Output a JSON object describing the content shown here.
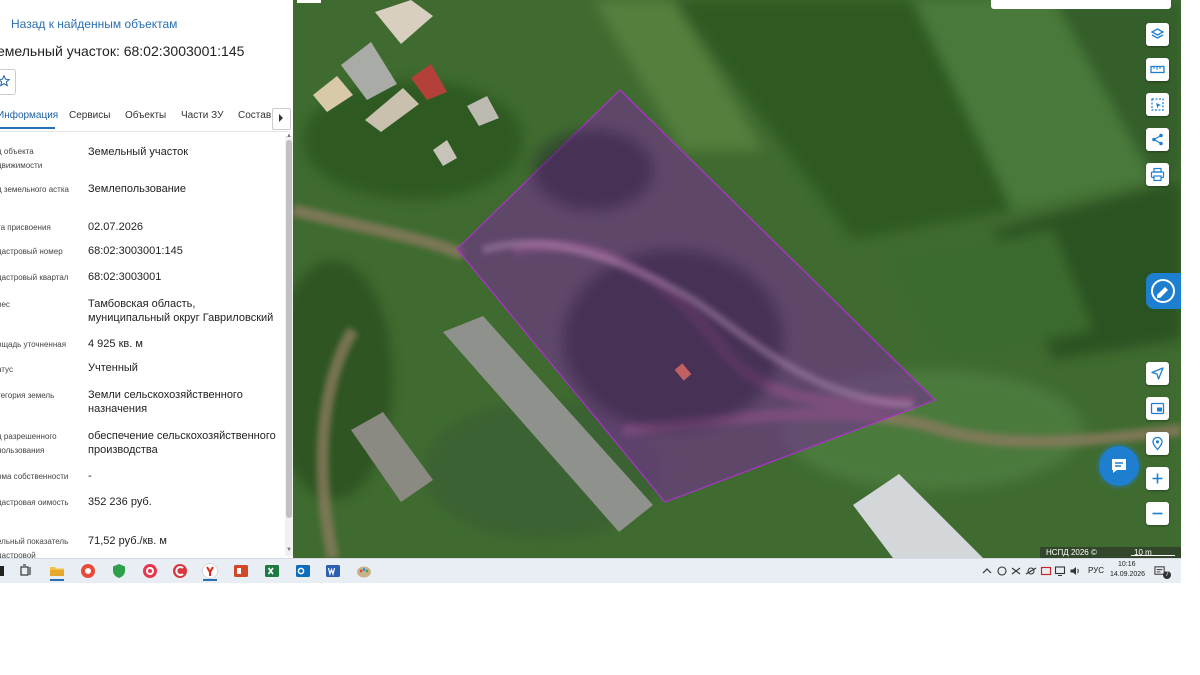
{
  "panel": {
    "back_link": "Назад к найденным объектам",
    "title": "емельный участок: 68:02:3003001:145",
    "tabs": [
      {
        "label": "Информация",
        "active": true
      },
      {
        "label": "Сервисы",
        "active": false
      },
      {
        "label": "Объекты",
        "active": false
      },
      {
        "label": "Части ЗУ",
        "active": false
      },
      {
        "label": "Состав",
        "active": false
      }
    ],
    "properties": [
      {
        "label": "д объекта движимости",
        "value": "Земельный участок"
      },
      {
        "label": "д земельного астка",
        "value": "Землепользование"
      },
      {
        "label": "та присвоения",
        "value": "02.07.2026"
      },
      {
        "label": "дастровый номер",
        "value": "68:02:3003001:145"
      },
      {
        "label": "дастровый квартал",
        "value": "68:02:3003001"
      },
      {
        "label": "рес",
        "value": "Тамбовская область, муниципальный округ Гавриловский"
      },
      {
        "label": "ощадь уточненная",
        "value": "4 925 кв. м"
      },
      {
        "label": "атус",
        "value": "Учтенный"
      },
      {
        "label": "тегория земель",
        "value": "Земли сельскохозяйственного назначения"
      },
      {
        "label": "д разрешенного пользования",
        "value": "обеспечение сельскохозяйственного производства"
      },
      {
        "label": "рма собственности",
        "value": "-"
      },
      {
        "label": "дастровая оимость",
        "value": "352 236 руб."
      },
      {
        "label": "ельный показатель дастровой",
        "value": "71,52 руб./кв. м"
      }
    ]
  },
  "map": {
    "copyright": "НСПД 2026 ©",
    "scale": "10 m",
    "parcel_color": "#a020c0",
    "right_controls": [
      "layers-icon",
      "ruler-icon",
      "select-area-icon",
      "share-icon",
      "print-icon"
    ],
    "lower_controls": [
      "locate-icon",
      "map-view-icon",
      "geolocation-icon",
      "zoom-in-icon",
      "zoom-out-icon"
    ]
  },
  "taskbar": {
    "apps": [
      "start-icon",
      "task-view-icon",
      "file-explorer-icon",
      "app-red-icon",
      "shield-app-icon",
      "app-pink-icon",
      "app-c-icon",
      "yandex-browser-icon",
      "powerpoint-icon",
      "excel-icon",
      "outlook-icon",
      "word-icon",
      "paint-icon"
    ],
    "language": "РУС",
    "time": "10:16",
    "date": "14.09.2026",
    "notifications": "7"
  }
}
